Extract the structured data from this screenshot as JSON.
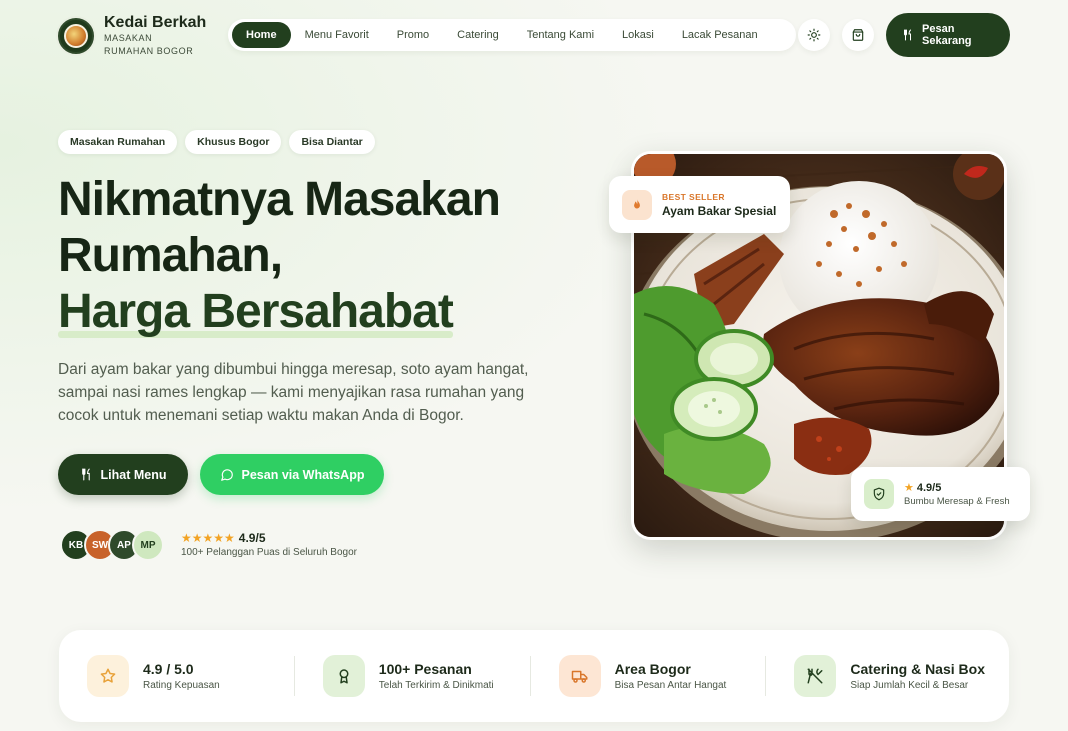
{
  "brand": {
    "name": "Kedai Berkah",
    "tagline": "MASAKAN RUMAHAN BOGOR"
  },
  "nav": {
    "items": [
      {
        "label": "Home",
        "active": true
      },
      {
        "label": "Menu Favorit",
        "active": false
      },
      {
        "label": "Promo",
        "active": false
      },
      {
        "label": "Catering",
        "active": false
      },
      {
        "label": "Tentang Kami",
        "active": false
      },
      {
        "label": "Lokasi",
        "active": false
      },
      {
        "label": "Lacak Pesanan",
        "active": false
      }
    ],
    "theme_icon": "sun-icon",
    "cart_icon": "shopping-bag-icon",
    "cta_label": "Pesan Sekarang",
    "cta_icon": "utensils-icon"
  },
  "hero": {
    "chips": [
      "Masakan Rumahan",
      "Khusus Bogor",
      "Bisa Diantar"
    ],
    "headline_line1": "Nikmatnya Masakan",
    "headline_line2": "Rumahan,",
    "headline_accent": "Harga Bersahabat",
    "subtext": "Dari ayam bakar yang dibumbui hingga meresap, soto ayam hangat, sampai nasi rames lengkap — kami menyajikan rasa rumahan yang cocok untuk menemani setiap waktu makan Anda di Bogor.",
    "primary_button": "Lihat Menu",
    "whatsapp_button": "Pesan via WhatsApp",
    "avatars": [
      {
        "initials": "KB",
        "color": "#223f1e",
        "text_color": "#ffffff"
      },
      {
        "initials": "SW",
        "color": "#c8622a",
        "text_color": "#ffffff"
      },
      {
        "initials": "AP",
        "color": "#2f4a2b",
        "text_color": "#ffffff"
      },
      {
        "initials": "MP",
        "color": "#cfe8bf",
        "text_color": "#223f1e"
      }
    ],
    "rating_stars": "★★★★★",
    "rating_score": "4.9/5",
    "rating_caption": "100+ Pelanggan Puas di Seluruh Bogor"
  },
  "featured": {
    "best_seller_kicker": "BEST SELLER",
    "best_seller_title": "Ayam Bakar Spesial",
    "best_seller_icon": "flame-icon",
    "rating_score": "4.9/5",
    "rating_caption": "Bumbu Meresap & Fresh",
    "rating_icon": "shield-check-icon"
  },
  "stats": [
    {
      "title": "4.9 / 5.0",
      "subtitle": "Rating Kepuasan",
      "icon": "star-icon"
    },
    {
      "title": "100+ Pesanan",
      "subtitle": "Telah Terkirim & Dinikmati",
      "icon": "award-icon"
    },
    {
      "title": "Area Bogor",
      "subtitle": "Bisa Pesan Antar Hangat",
      "icon": "truck-icon"
    },
    {
      "title": "Catering & Nasi Box",
      "subtitle": "Siap Jumlah Kecil & Besar",
      "icon": "utensils-crossed-icon"
    }
  ],
  "colors": {
    "primary": "#223f1e",
    "whatsapp": "#2fcf63",
    "accent_orange": "#d9762a",
    "star": "#f2a324",
    "background": "#f6f7f2"
  }
}
